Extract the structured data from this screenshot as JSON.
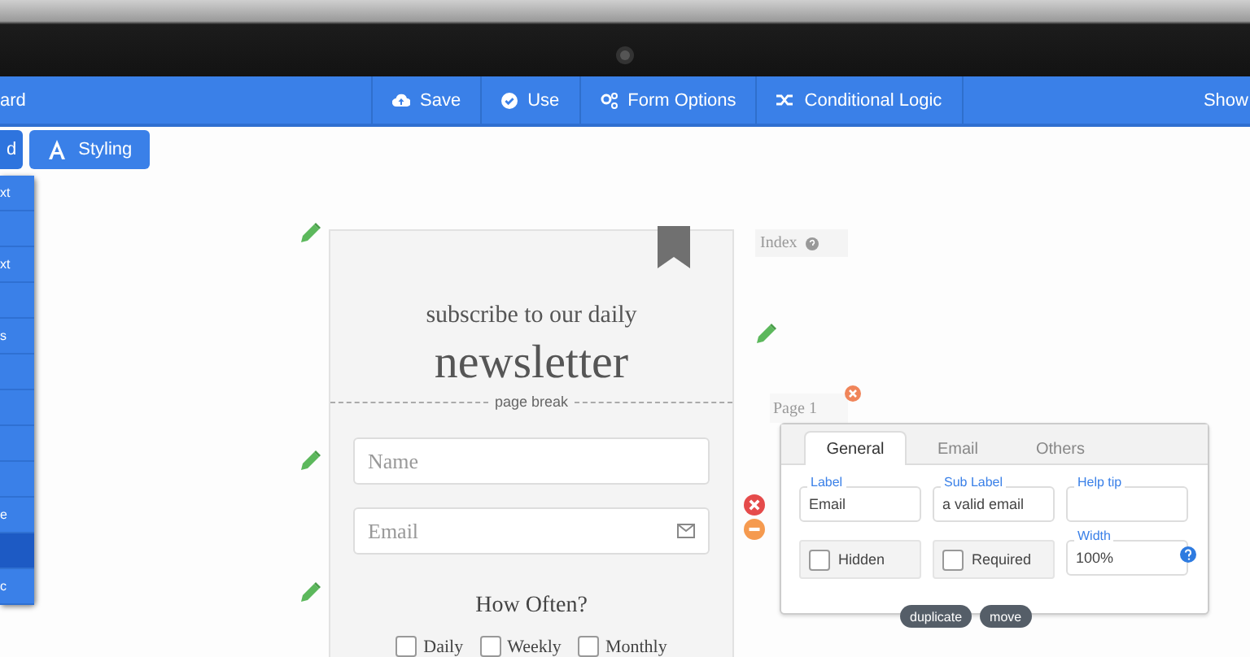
{
  "toolbar": {
    "left_label": "ard",
    "actions": [
      {
        "label": "Save"
      },
      {
        "label": "Use"
      },
      {
        "label": "Form Options"
      },
      {
        "label": "Conditional Logic"
      }
    ],
    "right_label": "Show"
  },
  "mode_buttons": [
    {
      "label": "d"
    },
    {
      "label": "Styling"
    }
  ],
  "sidebar": {
    "items": [
      {
        "label": "xt",
        "selected": false
      },
      {
        "selected": false
      },
      {
        "label": "xt",
        "selected": false
      },
      {
        "selected": false
      },
      {
        "label": "s",
        "selected": false
      },
      {
        "selected": false
      },
      {
        "selected": false
      },
      {
        "selected": false
      },
      {
        "selected": false
      },
      {
        "label": "e",
        "selected": false
      },
      {
        "selected": true
      },
      {
        "label": "c",
        "selected": false
      }
    ]
  },
  "form": {
    "subtitle": "subscribe to our daily",
    "title": "newsletter",
    "page_break": "page break",
    "fields": [
      {
        "placeholder": "Name"
      },
      {
        "placeholder": "Email"
      }
    ],
    "question": "How Often?",
    "options": [
      {
        "label": "Daily",
        "checked": false
      },
      {
        "label": "Weekly",
        "checked": false
      },
      {
        "label": "Monthly",
        "checked": false
      }
    ]
  },
  "index_label": "Index",
  "page_label": "Page 1",
  "properties": {
    "tabs": [
      {
        "label": "General",
        "selected": true
      },
      {
        "label": "Email",
        "selected": false
      },
      {
        "label": "Others",
        "selected": false
      }
    ],
    "fields": [
      {
        "label": "Label",
        "value": "Email"
      },
      {
        "label": "Sub Label",
        "value": "a valid email"
      },
      {
        "label": "Help tip"
      },
      {
        "label": "Width",
        "value": "100%"
      }
    ],
    "checkboxes": [
      {
        "label": "Hidden",
        "checked": false
      },
      {
        "label": "Required",
        "checked": false
      }
    ],
    "actions": [
      "duplicate",
      "move"
    ]
  }
}
